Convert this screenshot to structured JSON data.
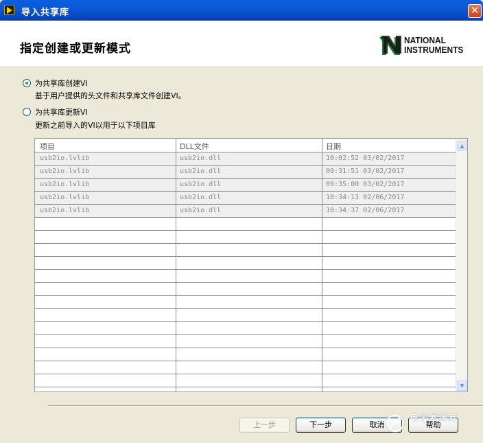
{
  "window": {
    "title": "导入共享库",
    "close_glyph": "✕"
  },
  "header": {
    "title": "指定创建或更新模式",
    "logo": {
      "line1": "NATIONAL",
      "line2": "INSTRUMENTS"
    }
  },
  "options": [
    {
      "label": "为共享库创建VI",
      "description": "基于用户提供的头文件和共享库文件创建VI。",
      "selected": true
    },
    {
      "label": "为共享库更新VI",
      "description": "更新之前导入的VI以用于以下项目库",
      "selected": false
    }
  ],
  "table": {
    "columns": [
      "项目",
      "DLL文件",
      "日期"
    ],
    "rows": [
      [
        "usb2io.lvlib",
        "usb2io.dll",
        "10:02:52 03/02/2017"
      ],
      [
        "usb2io.lvlib",
        "usb2io.dll",
        "09:31:51 03/02/2017"
      ],
      [
        "usb2io.lvlib",
        "usb2io.dll",
        "09:35:00 03/02/2017"
      ],
      [
        "usb2io.lvlib",
        "usb2io.dll",
        "10:34:13 02/06/2017"
      ],
      [
        "usb2io.lvlib",
        "usb2io.dll",
        "10:34:37 02/06/2017"
      ]
    ]
  },
  "buttons": {
    "back": "上一步",
    "next": "下一步",
    "cancel": "取消",
    "help": "帮助"
  },
  "watermark": {
    "text": "电子发烧友"
  },
  "icons": {
    "app": "labview-icon",
    "close": "close-icon",
    "scroll_up": "scroll-up-icon",
    "scroll_down": "scroll-down-icon"
  }
}
